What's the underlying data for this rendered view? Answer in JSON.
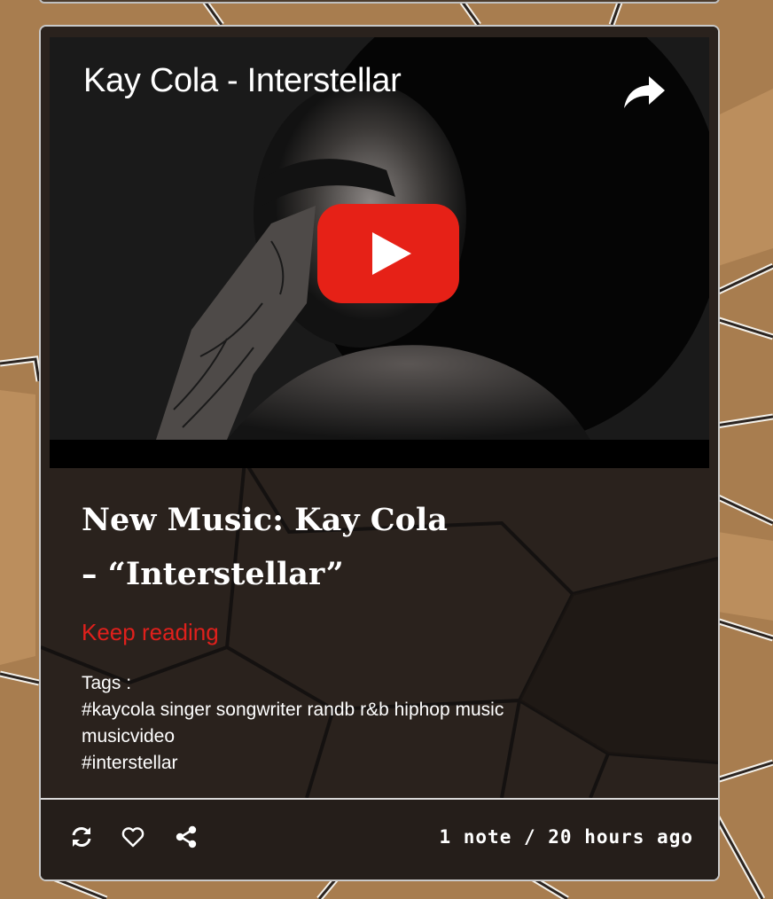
{
  "video": {
    "title": "Kay Cola - Interstellar",
    "icons": {
      "share": "share-arrow-icon",
      "play": "youtube-play-icon"
    }
  },
  "post": {
    "title_line1": "New Music: Kay Cola",
    "title_line2": "– “Interstellar”",
    "keep_reading": "Keep reading",
    "tags_label": "Tags :",
    "tags": [
      "#kaycola",
      "singer",
      "songwriter",
      "randb",
      "r&b",
      "hiphop",
      "music",
      "musicvideo",
      "#interstellar"
    ]
  },
  "footer": {
    "meta": "1 note / 20 hours ago",
    "icons": [
      "reblog-icon",
      "heart-icon",
      "share-icon"
    ]
  },
  "colors": {
    "link": "#e0201c",
    "youtube_red": "#e62117",
    "card_bg": "#2a221d"
  }
}
